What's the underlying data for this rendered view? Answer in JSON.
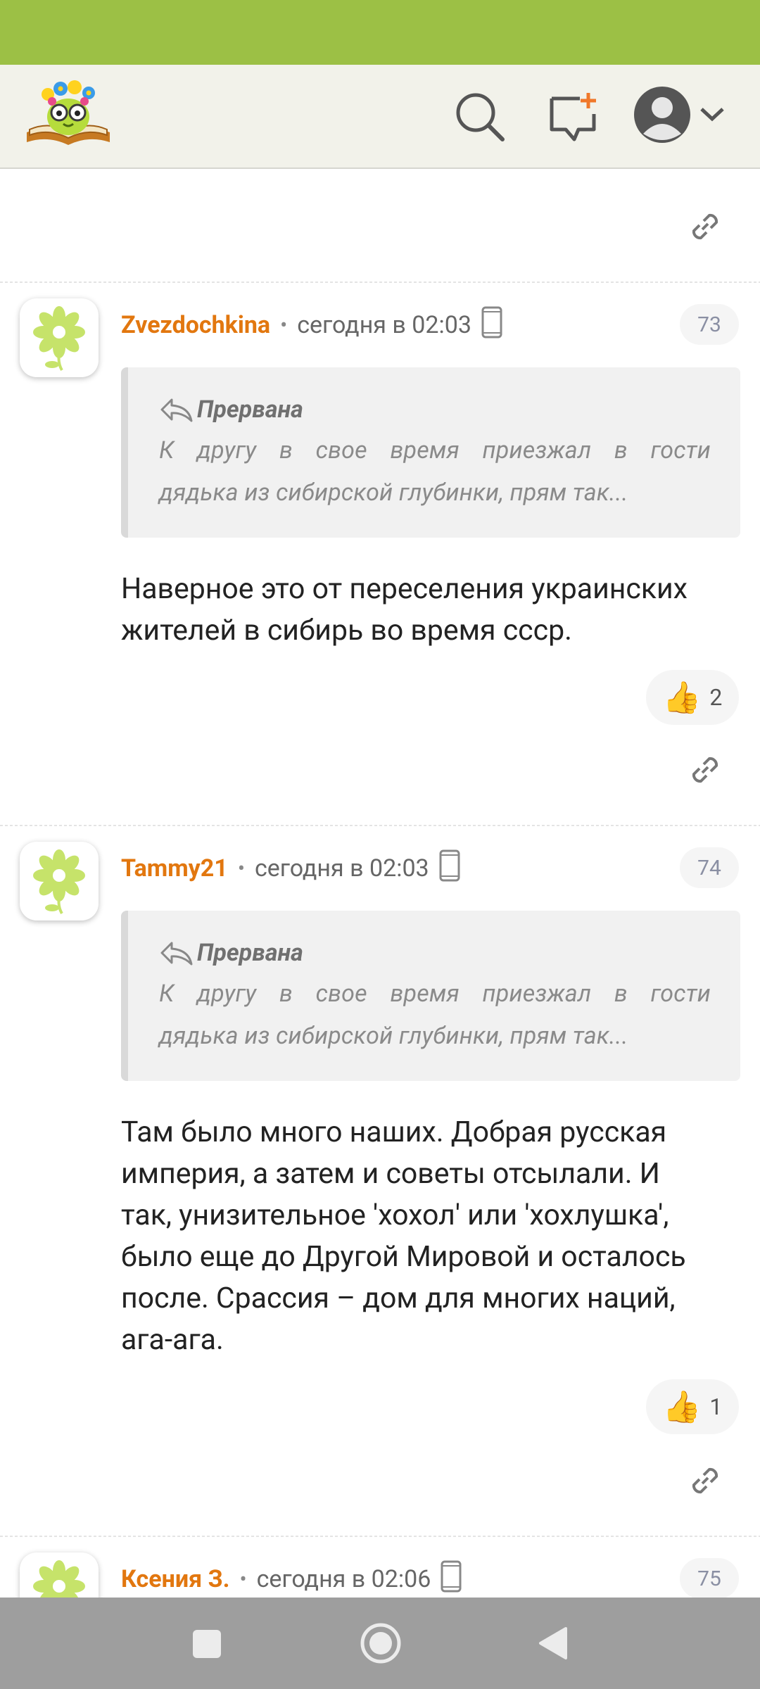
{
  "app": {
    "name": "Forum comments",
    "colors": {
      "status_bar": "#9cc045",
      "top_bar": "#f2f2ea",
      "author": "#e2770f",
      "nav_bar": "#9e9e9e"
    }
  },
  "header": {
    "icons": [
      "logo-icon",
      "search-icon",
      "new-post-icon",
      "profile-icon",
      "chevron-down-icon"
    ]
  },
  "comments": [
    {
      "author": "Zvezdochkina",
      "time": "сегодня в 02:03",
      "number": "73",
      "quote": {
        "author": "Прервана",
        "lines": [
          "К другу в свое время приезжал в гости",
          "дядька из сибирской глубинки, прям так..."
        ]
      },
      "body_lines": [
        "Наверное это от переселения украинских",
        "жителей в сибирь во время ссср."
      ],
      "likes": "2"
    },
    {
      "author": "Tammy21",
      "time": "сегодня в 02:03",
      "number": "74",
      "quote": {
        "author": "Прервана",
        "lines": [
          "К другу в свое время приезжал в гости",
          "дядька из сибирской глубинки, прям так..."
        ]
      },
      "body_lines": [
        "Там было много наших. Добрая русская",
        "империя, а затем и советы отсылали. И",
        "так, унизительное 'хохол' или 'хохлушка',",
        "было еще до Другой Мировой и осталось",
        "после. Срассия – дом для многих наций,",
        "ага-ага."
      ],
      "likes": "1"
    },
    {
      "author": "Ксения З.",
      "time": "сегодня в 02:06",
      "number": "75"
    }
  ],
  "separator": "•"
}
